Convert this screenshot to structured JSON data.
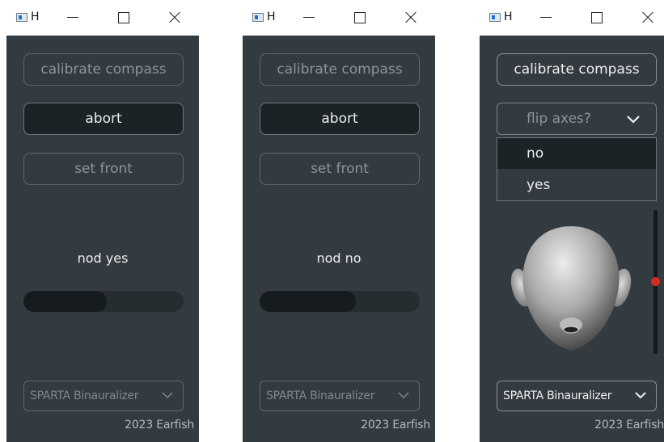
{
  "windows": [
    {
      "title": "H",
      "buttons": {
        "calibrate": "calibrate compass",
        "abort": "abort",
        "set_front": "set front"
      },
      "status": "nod yes",
      "progress": 0.52,
      "plugin_select": "SPARTA Binauralizer",
      "credit": "2023 Earfish"
    },
    {
      "title": "H",
      "buttons": {
        "calibrate": "calibrate compass",
        "abort": "abort",
        "set_front": "set front"
      },
      "status": "nod no",
      "progress": 0.6,
      "plugin_select": "SPARTA Binauralizer",
      "credit": "2023 Earfish"
    },
    {
      "title": "H",
      "buttons": {
        "calibrate": "calibrate compass"
      },
      "flip_axes": {
        "label": "flip axes?",
        "options": [
          "no",
          "yes"
        ],
        "highlighted": "no"
      },
      "slider": {
        "value": 0.47
      },
      "plugin_select": "SPARTA Binauralizer",
      "credit": "2023 Earfish"
    }
  ],
  "icons": {
    "app": "app-window-icon",
    "minimize": "minimize-icon",
    "maximize": "maximize-icon",
    "close": "close-icon",
    "dropdown": "chevron-down-icon",
    "head": "head-model-icon"
  },
  "colors": {
    "panel_bg": "#333b40",
    "active_button": "#1c2326",
    "progress_fill": "#161b1e",
    "slider_thumb": "#d32b1f"
  }
}
